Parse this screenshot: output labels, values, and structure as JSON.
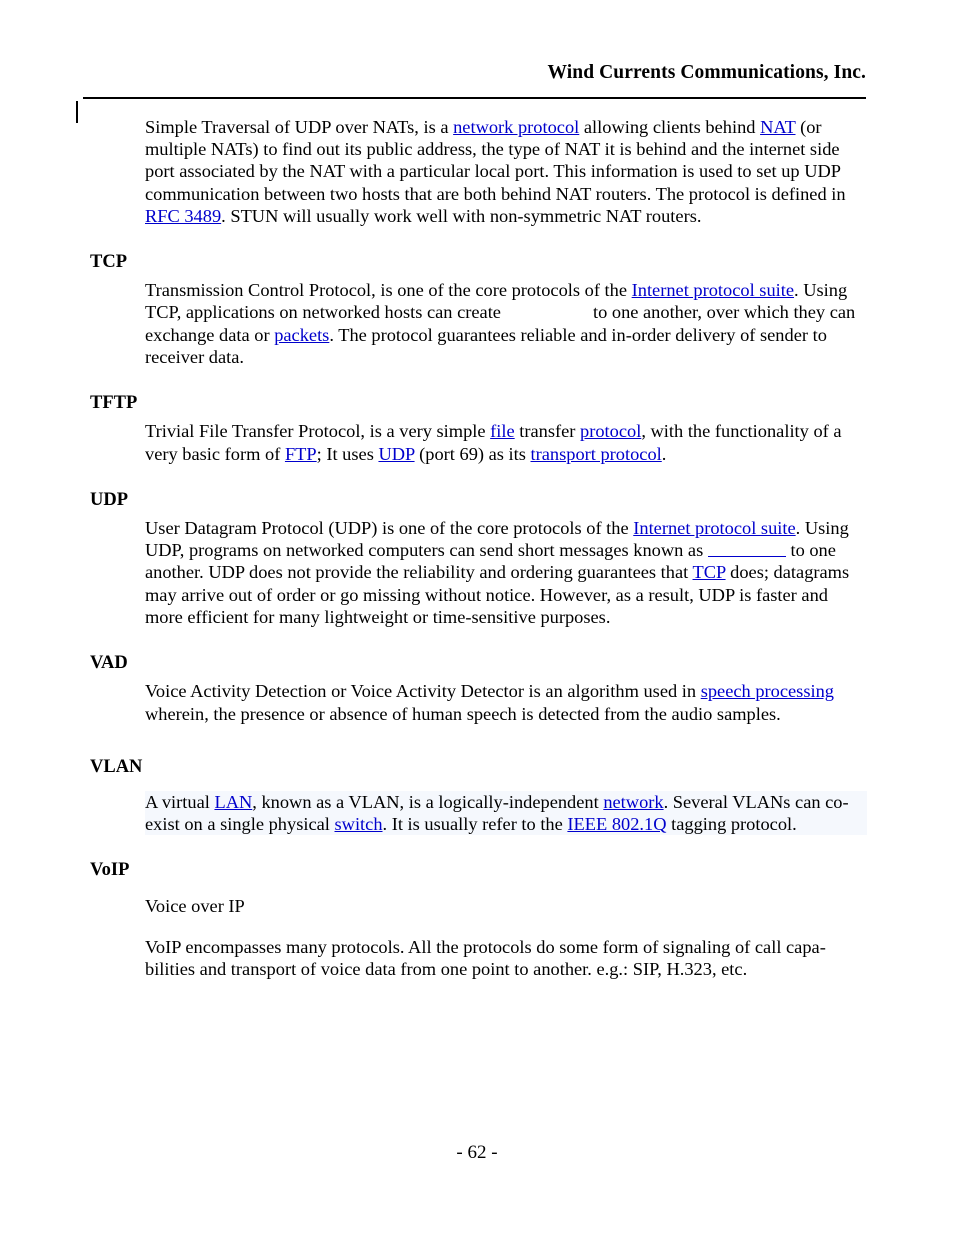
{
  "header": {
    "company": "Wind Currents Communications, Inc."
  },
  "footer": {
    "page_number": "- 62 -"
  },
  "colors": {
    "link": "#0000CC",
    "text": "#000000",
    "highlight_background": "#F5F8FD",
    "page_background": "#FFFFFF"
  },
  "sections": {
    "stun": {
      "t1": "Simple Traversal of UDP over NATs, is a ",
      "l1": "network protocol",
      "t2": " allowing clients behind ",
      "l2": "NAT",
      "t3": " (or multiple NATs) to find out its public address, the type of NAT it is behind and the internet side port associated by the NAT with a particular local port. This information is used to set up UDP communication between two hosts that are both behind NAT routers. The protocol is defined in ",
      "l3": "RFC 3489",
      "t4": ". STUN will usually work well with non-symmetric NAT routers."
    },
    "tcp": {
      "heading": "TCP",
      "t1": "Transmission Control Protocol, is one of the core protocols of the ",
      "l1": "Internet protocol suite",
      "t2": ". Using TCP, applications on networked hosts can create",
      "t3": "to one another, over which they can exchange data or ",
      "l2": "packets",
      "t4": ". The protocol guarantees reliable and in-order delivery of sender to receiver data."
    },
    "tftp": {
      "heading": "TFTP",
      "t1": "Trivial File Transfer Protocol, is a very simple ",
      "l1": "file",
      "t2": " transfer ",
      "l2": "protocol",
      "t3": ", with the functionality of a very basic form of ",
      "l3": "FTP",
      "t4": "; It uses ",
      "l4": "UDP",
      "t5": " (port 69) as its ",
      "l5": "transport protocol",
      "t6": "."
    },
    "udp": {
      "heading": "UDP",
      "t1": "User Datagram Protocol (UDP) is one of the core protocols of the ",
      "l1": "Internet protocol suite",
      "t2": ". Using UDP, programs on networked computers can send short messages known as ",
      "t3": " to one another. UDP does not provide the reliability and ordering guarantees that ",
      "l2": "TCP",
      "t4": " does; datagrams may arrive out of order or go missing without notice. However, as a result, UDP is faster and more efficient for many lightweight or time-sensitive purposes."
    },
    "vad": {
      "heading": "VAD",
      "t1": "Voice Activity Detection or Voice Activity Detector is an algorithm used in ",
      "l1": "speech processing",
      "t2": " wherein, the presence or absence of human speech is detected from the audio samples."
    },
    "vlan": {
      "heading": "VLAN",
      "t1": "A virtual ",
      "l1": "LAN",
      "t2": ", known as a VLAN, is a logically-independent ",
      "l2": "network",
      "t3": ". Several VLANs can co-exist on a single physical ",
      "l3": "switch",
      "t4": ". It is usually refer to the ",
      "l4": "IEEE 802.1Q",
      "t5": " tagging protocol."
    },
    "voip": {
      "heading": "VoIP",
      "p1": "Voice over IP",
      "p2": "VoIP encompasses many protocols. All the protocols do some form of signaling of call capa-bilities and transport of voice data from one point to another. e.g.: SIP, H.323, etc."
    }
  }
}
